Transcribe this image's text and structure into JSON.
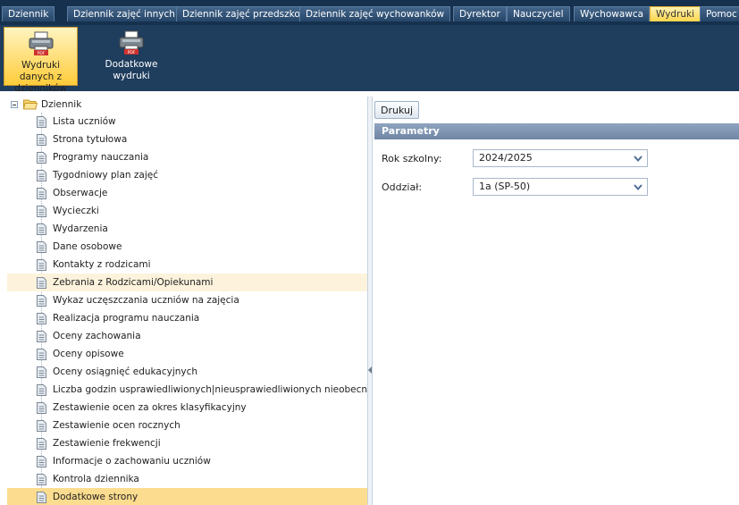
{
  "menu": {
    "items": [
      {
        "label": "Dziennik"
      },
      {
        "label": "Dziennik zajęć innych"
      },
      {
        "label": "Dziennik zajęć przedszkola"
      },
      {
        "label": "Dziennik zajęć wychowanków"
      },
      {
        "label": "Dyrektor"
      },
      {
        "label": "Nauczyciel"
      },
      {
        "label": "Wychowawca"
      },
      {
        "label": "Wydruki",
        "active": true
      },
      {
        "label": "Pomoc"
      }
    ]
  },
  "ribbon": {
    "buttons": [
      {
        "line1": "Wydruki danych z",
        "line2": "dzienników",
        "icon": "pdf-printer-icon",
        "active": true
      },
      {
        "line1": "Dodatkowe",
        "line2": "wydruki",
        "icon": "pdf-printer-icon",
        "active": false
      }
    ]
  },
  "tree": {
    "root_label": "Dziennik",
    "items": [
      {
        "label": "Lista uczniów"
      },
      {
        "label": "Strona tytułowa"
      },
      {
        "label": "Programy nauczania"
      },
      {
        "label": "Tygodniowy plan zajęć"
      },
      {
        "label": "Obserwacje"
      },
      {
        "label": "Wycieczki"
      },
      {
        "label": "Wydarzenia"
      },
      {
        "label": "Dane osobowe"
      },
      {
        "label": "Kontakty z rodzicami"
      },
      {
        "label": "Zebrania z Rodzicami/Opiekunami",
        "state": "hover"
      },
      {
        "label": "Wykaz uczęszczania uczniów na zajęcia"
      },
      {
        "label": "Realizacja programu nauczania"
      },
      {
        "label": "Oceny zachowania"
      },
      {
        "label": "Oceny opisowe"
      },
      {
        "label": "Oceny osiągnięć edukacyjnych"
      },
      {
        "label": "Liczba godzin usprawiedliwionych|nieusprawiedliwionych nieobecności n"
      },
      {
        "label": "Zestawienie ocen za okres klasyfikacyjny"
      },
      {
        "label": "Zestawienie ocen rocznych"
      },
      {
        "label": "Zestawienie frekwencji"
      },
      {
        "label": "Informacje o zachowaniu uczniów"
      },
      {
        "label": "Kontrola dziennika"
      },
      {
        "label": "Dodatkowe strony",
        "state": "selected"
      }
    ]
  },
  "right": {
    "print_label": "Drukuj",
    "params_title": "Parametry",
    "fields": [
      {
        "label": "Rok szkolny:",
        "value": "2024/2025"
      },
      {
        "label": "Oddział:",
        "value": "1a (SP-50)"
      }
    ]
  },
  "colors": {
    "menubar": "#16314e",
    "ribbon": "#1f3d5d",
    "active_tab": "#ffd54a",
    "selected_row": "#fcdc8e",
    "hover_row": "#fdf3dc",
    "params_header": "#7b90ad"
  }
}
